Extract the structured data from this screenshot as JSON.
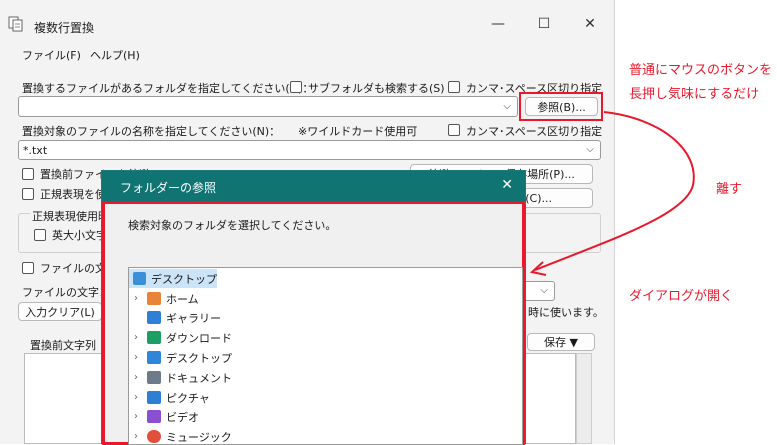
{
  "window": {
    "title": "複数行置換",
    "minimize": "—",
    "maximize": "☐",
    "close": "✕"
  },
  "menu": [
    "ファイル(F)",
    "ヘルプ(H)"
  ],
  "form": {
    "folder_label": "置換するファイルがあるフォルダを指定してください(D)：",
    "subfolder_label": "サブフォルダも検索する(S)",
    "csv_label_1": "カンマ･スペース区切り指定",
    "folder_value": "",
    "browse_button": "参照(B)...",
    "filename_label": "置換対象のファイルの名称を指定してください(N)：",
    "wildcard_note": "※ワイルドカード使用可",
    "csv_label_2": "カンマ･スペース区切り指定",
    "filename_value": "*.txt",
    "backup_label": "置換前ファイルを待避(K)",
    "regex_label": "正規表現を使",
    "btn_right_1": "待避ファイルの保存場所(P)...",
    "btn_right_2": "(C)...",
    "regex_group_label": "正規表現使用時",
    "case_label": "英大小文字",
    "encoding_check_label": "ファイルの文字",
    "encoding_label": "ファイルの文字コー",
    "encoding_hint": "時に使います。",
    "clear_button": "入力クリア(L)",
    "before_label": "置換前文字列",
    "save_button": "保存 ▼"
  },
  "dialog": {
    "title": "フォルダーの参照",
    "close": "✕",
    "instruction": "検索対象のフォルダを選択してください。",
    "tree": [
      {
        "label": "デスクトップ",
        "expand": "",
        "icon": "desktop-icon",
        "color": "#3a8fd8",
        "selected": true
      },
      {
        "label": "ホーム",
        "expand": "›",
        "icon": "home-icon",
        "color": "#e8833a"
      },
      {
        "label": "ギャラリー",
        "expand": "",
        "icon": "gallery-icon",
        "color": "#2f7fd6"
      },
      {
        "label": "ダウンロード",
        "expand": "›",
        "icon": "download-icon",
        "color": "#1d9e62"
      },
      {
        "label": "デスクトップ",
        "expand": "›",
        "icon": "desktop-folder-icon",
        "color": "#2f86d8"
      },
      {
        "label": "ドキュメント",
        "expand": "›",
        "icon": "document-icon",
        "color": "#6d7a8a"
      },
      {
        "label": "ピクチャ",
        "expand": "›",
        "icon": "pictures-icon",
        "color": "#2d7fd6"
      },
      {
        "label": "ビデオ",
        "expand": "›",
        "icon": "video-icon",
        "color": "#8a4fd1"
      },
      {
        "label": "ミュージック",
        "expand": "›",
        "icon": "music-icon",
        "color": "#e0503a"
      }
    ]
  },
  "annotations": {
    "line1": "普通にマウスのボタンを",
    "line2": "長押し気味にするだけ",
    "release": "離す",
    "opens": "ダイアログが開く"
  },
  "colors": {
    "annotation_red": "#e8192c",
    "dialog_titlebar": "#0f7472"
  }
}
